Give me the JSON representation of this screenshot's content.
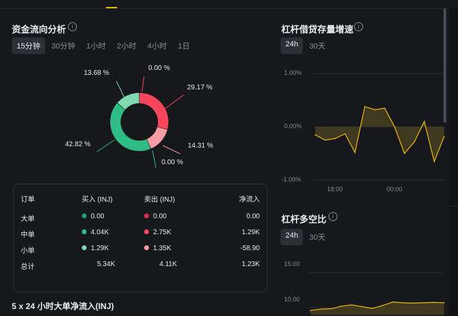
{
  "money_flow": {
    "title": "资金流向分析",
    "tabs": [
      {
        "label": "15分钟",
        "active": true
      },
      {
        "label": "30分钟",
        "active": false
      },
      {
        "label": "1小时",
        "active": false
      },
      {
        "label": "2小时",
        "active": false
      },
      {
        "label": "4小时",
        "active": false
      },
      {
        "label": "1日",
        "active": false
      }
    ],
    "donut": {
      "slices": [
        {
          "label": "0.00 %",
          "value": 0.0,
          "color": "#f6465d"
        },
        {
          "label": "29.17 %",
          "value": 29.17,
          "color": "#f6465d"
        },
        {
          "label": "14.31 %",
          "value": 14.31,
          "color": "#f89ca3"
        },
        {
          "label": "0.00 %",
          "value": 0.0,
          "color": "#2ebd85"
        },
        {
          "label": "42.82 %",
          "value": 42.82,
          "color": "#2ebd85"
        },
        {
          "label": "13.68 %",
          "value": 13.68,
          "color": "#7fd9b1"
        }
      ]
    },
    "table": {
      "headers": [
        "订单",
        "买入 (INJ)",
        "卖出 (INJ)",
        "净流入"
      ],
      "rows": [
        {
          "name": "大单",
          "buy": "0.00",
          "buy_color": "#1e9e6a",
          "sell": "0.00",
          "sell_color": "#d9304a",
          "net": "0.00"
        },
        {
          "name": "中单",
          "buy": "4.04K",
          "buy_color": "#2ebd85",
          "sell": "2.75K",
          "sell_color": "#f6465d",
          "net": "1.29K"
        },
        {
          "name": "小单",
          "buy": "1.29K",
          "buy_color": "#7fd9b1",
          "sell": "1.35K",
          "sell_color": "#f89ca3",
          "net": "-58.90"
        },
        {
          "name": "总计",
          "buy": "5.34K",
          "sell": "4.11K",
          "net": "1.23K"
        }
      ]
    },
    "bottom_title": "5 x 24 小时大单净流入(INJ)"
  },
  "leverage_growth": {
    "title": "杠杆借贷存量增速",
    "tabs": [
      {
        "label": "24h",
        "active": true
      },
      {
        "label": "30天",
        "active": false
      }
    ],
    "chart_data": {
      "type": "area",
      "y_tick_labels": [
        "1.00%",
        "0.00%",
        "-1.00%"
      ],
      "ylim": [
        -1.0,
        1.0
      ],
      "x_tick_labels": [
        "18:00",
        "00:00"
      ],
      "values": [
        -0.15,
        -0.25,
        -0.22,
        -0.13,
        -0.48,
        0.38,
        0.32,
        0.35,
        0.0,
        -0.5,
        -0.28,
        0.1,
        -0.65,
        -0.18
      ],
      "line_color": "#f0b90b",
      "fill_color": "#4a4220"
    }
  },
  "long_short": {
    "title": "杠杆多空比",
    "tabs": [
      {
        "label": "24h",
        "active": true
      },
      {
        "label": "30天",
        "active": false
      }
    ],
    "chart_data": {
      "type": "area",
      "y_tick_labels": [
        "15.00",
        "10.00"
      ],
      "ylim": [
        10.0,
        15.0
      ],
      "values": [
        9.6,
        9.8,
        9.85,
        10.2,
        10.4,
        10.15,
        9.9,
        10.3,
        10.8,
        10.7,
        10.65,
        10.7,
        10.75,
        10.7
      ],
      "line_color": "#f0b90b",
      "fill_color": "#4a4220"
    }
  }
}
